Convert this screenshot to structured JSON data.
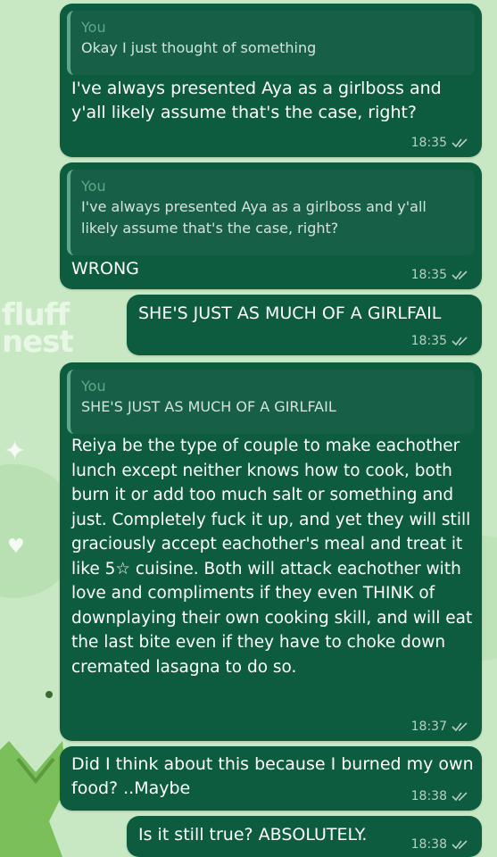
{
  "messages": [
    {
      "quote": {
        "author": "You",
        "text": "Okay I just thought of something"
      },
      "text": "I've always presented Aya as a girlboss and y'all likely assume that's the case, right?",
      "time": "18:35"
    },
    {
      "quote": {
        "author": "You",
        "text": "I've always presented Aya as a girlboss and y'all likely assume that's the case, right?"
      },
      "text": "WRONG",
      "time": "18:35"
    },
    {
      "text": "SHE'S JUST AS MUCH OF A GIRLFAIL",
      "time": "18:35"
    },
    {
      "quote": {
        "author": "You",
        "text": "SHE'S JUST AS MUCH OF A GIRLFAIL"
      },
      "text": "Reiya be the type of couple to make eachother lunch except neither knows how to cook, both burn it or add too much salt or something and just. Completely fuck it up, and yet they will still graciously accept eachother's meal and treat it like 5☆ cuisine. Both will attack eachother with love and compliments if they even THINK of downplaying their own cooking skill, and will eat the last bite even if they have to choke down cremated lasagna to do so.",
      "time": "18:37"
    },
    {
      "text": "Did I think about this because I burned my own food? ..Maybe",
      "time": "18:38"
    },
    {
      "text": "Is it still true? ABSOLUTELY.",
      "time": "18:38"
    }
  ],
  "wallpaper": {
    "logo_line1": "fluff",
    "logo_line2": "nest"
  },
  "status_icon": "double-check-icon",
  "colors": {
    "bubble": "#0d5c3f",
    "quote_bg": "#175f46",
    "quote_bar": "#5fa98a",
    "wallpaper": "#c8e8c4"
  }
}
